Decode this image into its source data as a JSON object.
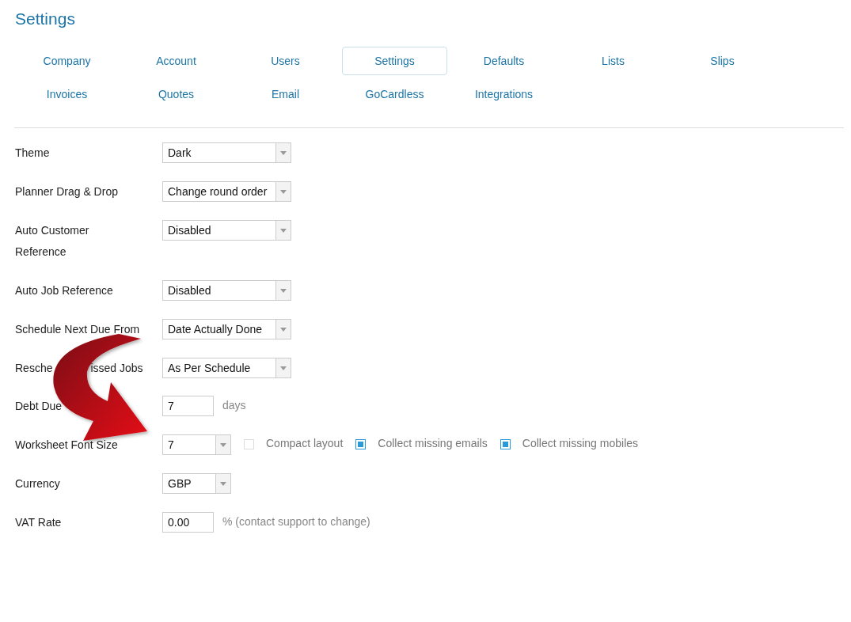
{
  "title": "Settings",
  "tabs": [
    {
      "label": "Company",
      "selected": false
    },
    {
      "label": "Account",
      "selected": false
    },
    {
      "label": "Users",
      "selected": false
    },
    {
      "label": "Settings",
      "selected": true
    },
    {
      "label": "Defaults",
      "selected": false
    },
    {
      "label": "Lists",
      "selected": false
    },
    {
      "label": "Slips",
      "selected": false
    },
    {
      "label": "Invoices",
      "selected": false
    },
    {
      "label": "Quotes",
      "selected": false
    },
    {
      "label": "Email",
      "selected": false
    },
    {
      "label": "GoCardless",
      "selected": false
    },
    {
      "label": "Integrations",
      "selected": false
    }
  ],
  "rows": [
    {
      "label": [
        "Theme"
      ],
      "kind": "select",
      "value": "Dark"
    },
    {
      "label": [
        "Planner Drag & Drop"
      ],
      "kind": "select",
      "value": "Change round order"
    },
    {
      "label": [
        "Auto Customer Reference"
      ],
      "kind": "select",
      "value": "Disabled"
    },
    {
      "label": [
        "Auto Job Reference"
      ],
      "kind": "select",
      "value": "Disabled"
    },
    {
      "label": [
        "Schedule Next Due From"
      ],
      "kind": "select",
      "value": "Date Actually Done"
    },
    {
      "label": [
        "Resche",
        "issed Jobs"
      ],
      "kind": "select",
      "value": "As Per Schedule"
    },
    {
      "label": [
        "Debt Due"
      ],
      "kind": "input",
      "value": "7",
      "suffix": "days"
    },
    {
      "label": [
        "Worksheet Font Size"
      ],
      "kind": "small-select",
      "value": "7",
      "options": [
        {
          "label": "Compact layout",
          "checked": false
        },
        {
          "label": "Collect missing emails",
          "checked": true
        },
        {
          "label": "Collect missing mobiles",
          "checked": true
        }
      ]
    },
    {
      "label": [
        "Currency"
      ],
      "kind": "small-select",
      "value": "GBP"
    },
    {
      "label": [
        "VAT Rate"
      ],
      "kind": "input",
      "value": "0.00",
      "suffix": "% (contact support to change)"
    }
  ]
}
